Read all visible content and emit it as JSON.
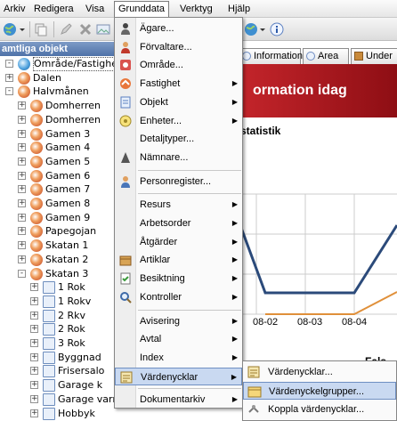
{
  "menubar": {
    "items": [
      "Arkiv",
      "Redigera",
      "Visa",
      "Grunddata",
      "Verktyg",
      "Hjälp"
    ]
  },
  "panel": {
    "title": "amtliga objekt"
  },
  "tree": [
    {
      "label": "Område/Fastighet",
      "level": 0,
      "expander": "-",
      "icon": "globe"
    },
    {
      "label": "Dalen",
      "level": 1,
      "expander": "+",
      "icon": "obj"
    },
    {
      "label": "Halvmånen",
      "level": 1,
      "expander": "-",
      "icon": "obj"
    },
    {
      "label": "Domherren",
      "level": 2,
      "expander": "+",
      "icon": "obj"
    },
    {
      "label": "Domherren",
      "level": 2,
      "expander": "+",
      "icon": "obj"
    },
    {
      "label": "Gamen 3",
      "level": 2,
      "expander": "+",
      "icon": "obj"
    },
    {
      "label": "Gamen 4",
      "level": 2,
      "expander": "+",
      "icon": "obj"
    },
    {
      "label": "Gamen 5",
      "level": 2,
      "expander": "+",
      "icon": "obj"
    },
    {
      "label": "Gamen 6",
      "level": 2,
      "expander": "+",
      "icon": "obj"
    },
    {
      "label": "Gamen 7",
      "level": 2,
      "expander": "+",
      "icon": "obj"
    },
    {
      "label": "Gamen 8",
      "level": 2,
      "expander": "+",
      "icon": "obj"
    },
    {
      "label": "Gamen 9",
      "level": 2,
      "expander": "+",
      "icon": "obj"
    },
    {
      "label": "Papegojan",
      "level": 2,
      "expander": "+",
      "icon": "obj"
    },
    {
      "label": "Skatan 1",
      "level": 2,
      "expander": "+",
      "icon": "obj"
    },
    {
      "label": "Skatan 2",
      "level": 2,
      "expander": "+",
      "icon": "obj"
    },
    {
      "label": "Skatan 3",
      "level": 2,
      "expander": "-",
      "icon": "obj"
    },
    {
      "label": "1 Rok",
      "level": 3,
      "expander": "+",
      "icon": "doc"
    },
    {
      "label": "1 Rokv",
      "level": 3,
      "expander": "+",
      "icon": "doc"
    },
    {
      "label": "2 Rkv",
      "level": 3,
      "expander": "+",
      "icon": "doc"
    },
    {
      "label": "2 Rok",
      "level": 3,
      "expander": "+",
      "icon": "doc"
    },
    {
      "label": "3 Rok",
      "level": 3,
      "expander": "+",
      "icon": "doc"
    },
    {
      "label": "Byggnad",
      "level": 3,
      "expander": "+",
      "icon": "doc"
    },
    {
      "label": "Frisersalo",
      "level": 3,
      "expander": "+",
      "icon": "doc"
    },
    {
      "label": "Garage k",
      "level": 3,
      "expander": "+",
      "icon": "doc"
    },
    {
      "label": "Garage varm",
      "level": 3,
      "expander": "+",
      "icon": "doc"
    },
    {
      "label": "Hobbyk",
      "level": 3,
      "expander": "+",
      "icon": "doc"
    }
  ],
  "tabs": [
    "Information",
    "Area",
    "Under"
  ],
  "banner": {
    "title": "ormation idag"
  },
  "stat_title": "statistik",
  "extra_label": "Fals",
  "chart_data": {
    "type": "line",
    "categories": [
      "08-02",
      "08-03",
      "08-04"
    ],
    "series": [
      {
        "values": [
          8,
          8,
          8
        ],
        "color": "#2b4a7a"
      },
      {
        "values": [
          0,
          0,
          0
        ],
        "color": "#e0903a"
      }
    ]
  },
  "menu": {
    "items": [
      {
        "label": "Ägare...",
        "icon": "owner-icon",
        "arrow": false
      },
      {
        "label": "Förvaltare...",
        "icon": "manager-icon",
        "arrow": false
      },
      {
        "label": "Område...",
        "icon": "area-icon",
        "arrow": false
      },
      {
        "label": "Fastighet",
        "icon": "property-icon",
        "arrow": true
      },
      {
        "label": "Objekt",
        "icon": "object-icon",
        "arrow": true
      },
      {
        "label": "Enheter...",
        "icon": "units-icon",
        "arrow": true
      },
      {
        "label": "Detaljtyper...",
        "icon": "",
        "arrow": false
      },
      {
        "label": "Nämnare...",
        "icon": "denominator-icon",
        "arrow": false
      },
      {
        "sep": true
      },
      {
        "label": "Personregister...",
        "icon": "person-icon",
        "arrow": false
      },
      {
        "sep": true
      },
      {
        "label": "Resurs",
        "icon": "",
        "arrow": true
      },
      {
        "label": "Arbetsorder",
        "icon": "",
        "arrow": true
      },
      {
        "label": "Åtgärder",
        "icon": "",
        "arrow": true
      },
      {
        "label": "Artiklar",
        "icon": "articles-icon",
        "arrow": true
      },
      {
        "label": "Besiktning",
        "icon": "inspection-icon",
        "arrow": true
      },
      {
        "label": "Kontroller",
        "icon": "search-icon",
        "arrow": true
      },
      {
        "sep": true
      },
      {
        "label": "Avisering",
        "icon": "",
        "arrow": true
      },
      {
        "label": "Avtal",
        "icon": "",
        "arrow": true
      },
      {
        "label": "Index",
        "icon": "",
        "arrow": true
      },
      {
        "label": "Värdenycklar",
        "icon": "valuekeys-icon",
        "arrow": true
      },
      {
        "sep": true
      },
      {
        "label": "Dokumentarkiv",
        "icon": "",
        "arrow": true
      }
    ],
    "highlighted": "Värdenycklar"
  },
  "submenu": {
    "items": [
      {
        "label": "Värdenycklar...",
        "icon": "valuekeys-icon"
      },
      {
        "label": "Värdenyckelgrupper...",
        "icon": "valuekey-groups-icon"
      },
      {
        "label": "Koppla värdenycklar...",
        "icon": "link-valuekeys-icon"
      }
    ],
    "highlighted": "Värdenyckelgrupper..."
  },
  "colors": {
    "banner": "#b71c22",
    "highlight": "#c9d9f1",
    "panel_title": "#5b7cb0"
  }
}
